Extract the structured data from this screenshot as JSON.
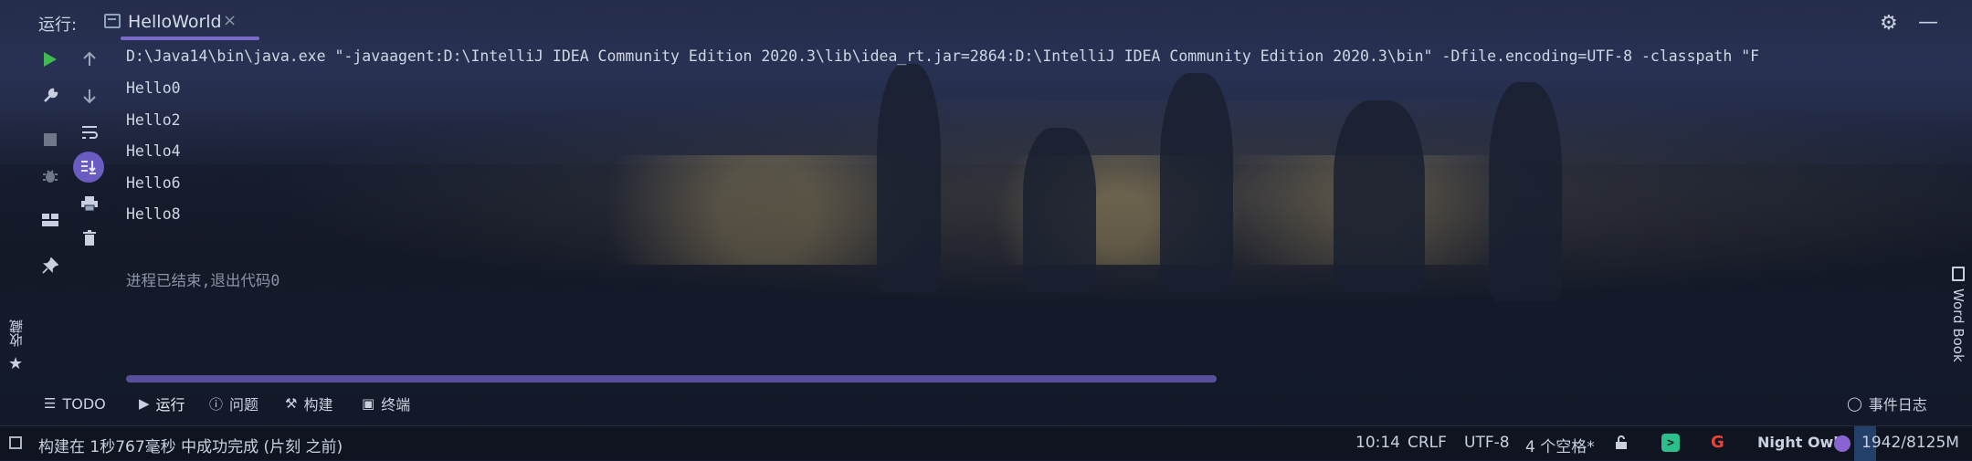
{
  "titlebar": {
    "run_label": "运行:",
    "tab_label": "HelloWorld",
    "tab_close": "×",
    "settings_icon": "gear-icon",
    "minimize_icon": "minimize-icon"
  },
  "left_toolbar": {
    "icons": [
      "play-icon",
      "up-arrow-icon",
      "wrench-icon",
      "down-arrow-icon",
      "stop-icon",
      "soft-wrap-icon",
      "debug-icon",
      "scroll-to-end-icon",
      "layout-icon",
      "print-icon",
      "pin-icon",
      "trash-icon"
    ]
  },
  "console": {
    "command": "D:\\Java14\\bin\\java.exe \"-javaagent:D:\\IntelliJ IDEA Community Edition 2020.3\\lib\\idea_rt.jar=2864:D:\\IntelliJ IDEA Community Edition 2020.3\\bin\" -Dfile.encoding=UTF-8 -classpath \"F",
    "output": [
      "Hello0",
      "Hello2",
      "Hello4",
      "Hello6",
      "Hello8"
    ],
    "exit_message": "进程已结束,退出代码0"
  },
  "side_left": {
    "label": "收藏",
    "icon": "star-icon"
  },
  "side_right": {
    "label": "Word Book",
    "icon": "book-icon"
  },
  "toolwindows": {
    "todo": "TODO",
    "run": "运行",
    "problems": "问题",
    "build": "构建",
    "terminal": "终端",
    "event_log": "事件日志"
  },
  "statusbar": {
    "build_message": "构建在 1秒767毫秒 中成功完成 (片刻 之前)",
    "caret": "10:14",
    "line_separator": "CRLF",
    "encoding": "UTF-8",
    "indent": "4 个空格*",
    "theme": "Night Owl",
    "memory": "1942/8125M"
  },
  "colors": {
    "accent": "#7a6bc9",
    "run_green": "#3fb950",
    "terminal_green": "#2bbf8c",
    "owl_purple": "#8a63d2"
  }
}
